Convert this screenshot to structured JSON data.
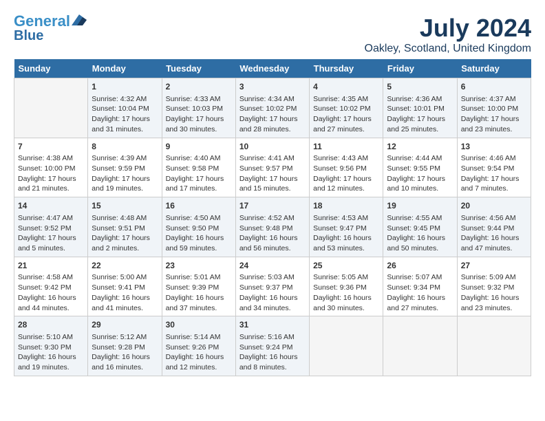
{
  "header": {
    "logo_general": "General",
    "logo_blue": "Blue",
    "month_year": "July 2024",
    "location": "Oakley, Scotland, United Kingdom"
  },
  "days_of_week": [
    "Sunday",
    "Monday",
    "Tuesday",
    "Wednesday",
    "Thursday",
    "Friday",
    "Saturday"
  ],
  "weeks": [
    [
      {
        "day": "",
        "sunrise": "",
        "sunset": "",
        "daylight": ""
      },
      {
        "day": "1",
        "sunrise": "Sunrise: 4:32 AM",
        "sunset": "Sunset: 10:04 PM",
        "daylight": "Daylight: 17 hours and 31 minutes."
      },
      {
        "day": "2",
        "sunrise": "Sunrise: 4:33 AM",
        "sunset": "Sunset: 10:03 PM",
        "daylight": "Daylight: 17 hours and 30 minutes."
      },
      {
        "day": "3",
        "sunrise": "Sunrise: 4:34 AM",
        "sunset": "Sunset: 10:02 PM",
        "daylight": "Daylight: 17 hours and 28 minutes."
      },
      {
        "day": "4",
        "sunrise": "Sunrise: 4:35 AM",
        "sunset": "Sunset: 10:02 PM",
        "daylight": "Daylight: 17 hours and 27 minutes."
      },
      {
        "day": "5",
        "sunrise": "Sunrise: 4:36 AM",
        "sunset": "Sunset: 10:01 PM",
        "daylight": "Daylight: 17 hours and 25 minutes."
      },
      {
        "day": "6",
        "sunrise": "Sunrise: 4:37 AM",
        "sunset": "Sunset: 10:00 PM",
        "daylight": "Daylight: 17 hours and 23 minutes."
      }
    ],
    [
      {
        "day": "7",
        "sunrise": "Sunrise: 4:38 AM",
        "sunset": "Sunset: 10:00 PM",
        "daylight": "Daylight: 17 hours and 21 minutes."
      },
      {
        "day": "8",
        "sunrise": "Sunrise: 4:39 AM",
        "sunset": "Sunset: 9:59 PM",
        "daylight": "Daylight: 17 hours and 19 minutes."
      },
      {
        "day": "9",
        "sunrise": "Sunrise: 4:40 AM",
        "sunset": "Sunset: 9:58 PM",
        "daylight": "Daylight: 17 hours and 17 minutes."
      },
      {
        "day": "10",
        "sunrise": "Sunrise: 4:41 AM",
        "sunset": "Sunset: 9:57 PM",
        "daylight": "Daylight: 17 hours and 15 minutes."
      },
      {
        "day": "11",
        "sunrise": "Sunrise: 4:43 AM",
        "sunset": "Sunset: 9:56 PM",
        "daylight": "Daylight: 17 hours and 12 minutes."
      },
      {
        "day": "12",
        "sunrise": "Sunrise: 4:44 AM",
        "sunset": "Sunset: 9:55 PM",
        "daylight": "Daylight: 17 hours and 10 minutes."
      },
      {
        "day": "13",
        "sunrise": "Sunrise: 4:46 AM",
        "sunset": "Sunset: 9:54 PM",
        "daylight": "Daylight: 17 hours and 7 minutes."
      }
    ],
    [
      {
        "day": "14",
        "sunrise": "Sunrise: 4:47 AM",
        "sunset": "Sunset: 9:52 PM",
        "daylight": "Daylight: 17 hours and 5 minutes."
      },
      {
        "day": "15",
        "sunrise": "Sunrise: 4:48 AM",
        "sunset": "Sunset: 9:51 PM",
        "daylight": "Daylight: 17 hours and 2 minutes."
      },
      {
        "day": "16",
        "sunrise": "Sunrise: 4:50 AM",
        "sunset": "Sunset: 9:50 PM",
        "daylight": "Daylight: 16 hours and 59 minutes."
      },
      {
        "day": "17",
        "sunrise": "Sunrise: 4:52 AM",
        "sunset": "Sunset: 9:48 PM",
        "daylight": "Daylight: 16 hours and 56 minutes."
      },
      {
        "day": "18",
        "sunrise": "Sunrise: 4:53 AM",
        "sunset": "Sunset: 9:47 PM",
        "daylight": "Daylight: 16 hours and 53 minutes."
      },
      {
        "day": "19",
        "sunrise": "Sunrise: 4:55 AM",
        "sunset": "Sunset: 9:45 PM",
        "daylight": "Daylight: 16 hours and 50 minutes."
      },
      {
        "day": "20",
        "sunrise": "Sunrise: 4:56 AM",
        "sunset": "Sunset: 9:44 PM",
        "daylight": "Daylight: 16 hours and 47 minutes."
      }
    ],
    [
      {
        "day": "21",
        "sunrise": "Sunrise: 4:58 AM",
        "sunset": "Sunset: 9:42 PM",
        "daylight": "Daylight: 16 hours and 44 minutes."
      },
      {
        "day": "22",
        "sunrise": "Sunrise: 5:00 AM",
        "sunset": "Sunset: 9:41 PM",
        "daylight": "Daylight: 16 hours and 41 minutes."
      },
      {
        "day": "23",
        "sunrise": "Sunrise: 5:01 AM",
        "sunset": "Sunset: 9:39 PM",
        "daylight": "Daylight: 16 hours and 37 minutes."
      },
      {
        "day": "24",
        "sunrise": "Sunrise: 5:03 AM",
        "sunset": "Sunset: 9:37 PM",
        "daylight": "Daylight: 16 hours and 34 minutes."
      },
      {
        "day": "25",
        "sunrise": "Sunrise: 5:05 AM",
        "sunset": "Sunset: 9:36 PM",
        "daylight": "Daylight: 16 hours and 30 minutes."
      },
      {
        "day": "26",
        "sunrise": "Sunrise: 5:07 AM",
        "sunset": "Sunset: 9:34 PM",
        "daylight": "Daylight: 16 hours and 27 minutes."
      },
      {
        "day": "27",
        "sunrise": "Sunrise: 5:09 AM",
        "sunset": "Sunset: 9:32 PM",
        "daylight": "Daylight: 16 hours and 23 minutes."
      }
    ],
    [
      {
        "day": "28",
        "sunrise": "Sunrise: 5:10 AM",
        "sunset": "Sunset: 9:30 PM",
        "daylight": "Daylight: 16 hours and 19 minutes."
      },
      {
        "day": "29",
        "sunrise": "Sunrise: 5:12 AM",
        "sunset": "Sunset: 9:28 PM",
        "daylight": "Daylight: 16 hours and 16 minutes."
      },
      {
        "day": "30",
        "sunrise": "Sunrise: 5:14 AM",
        "sunset": "Sunset: 9:26 PM",
        "daylight": "Daylight: 16 hours and 12 minutes."
      },
      {
        "day": "31",
        "sunrise": "Sunrise: 5:16 AM",
        "sunset": "Sunset: 9:24 PM",
        "daylight": "Daylight: 16 hours and 8 minutes."
      },
      {
        "day": "",
        "sunrise": "",
        "sunset": "",
        "daylight": ""
      },
      {
        "day": "",
        "sunrise": "",
        "sunset": "",
        "daylight": ""
      },
      {
        "day": "",
        "sunrise": "",
        "sunset": "",
        "daylight": ""
      }
    ]
  ]
}
